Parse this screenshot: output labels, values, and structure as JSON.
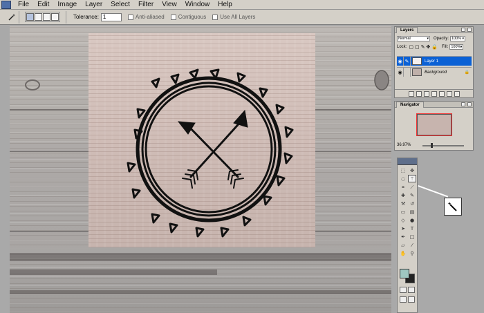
{
  "menubar": {
    "items": [
      "File",
      "Edit",
      "Image",
      "Layer",
      "Select",
      "Filter",
      "View",
      "Window",
      "Help"
    ]
  },
  "options": {
    "tolerance_label": "Tolerance:",
    "tolerance_value": "1",
    "anti_aliased": "Anti-aliased",
    "contiguous": "Contiguous",
    "use_all_layers": "Use All Layers"
  },
  "layers_panel": {
    "tab": "Layers",
    "blend_mode": "Normal",
    "opacity_label": "Opacity:",
    "opacity_value": "100%",
    "lock_label": "Lock:",
    "fill_label": "Fill:",
    "fill_value": "100%",
    "layers": [
      {
        "name": "Layer 1",
        "active": true
      },
      {
        "name": "Background",
        "active": false
      }
    ]
  },
  "navigator_panel": {
    "tab": "Navigator",
    "zoom": "36.97%"
  },
  "colors": {
    "foreground": "#9fc7c1",
    "background": "#222222",
    "selection_highlight": "#0b61d5"
  },
  "icons": {
    "active_tool": "magic-wand-icon"
  }
}
